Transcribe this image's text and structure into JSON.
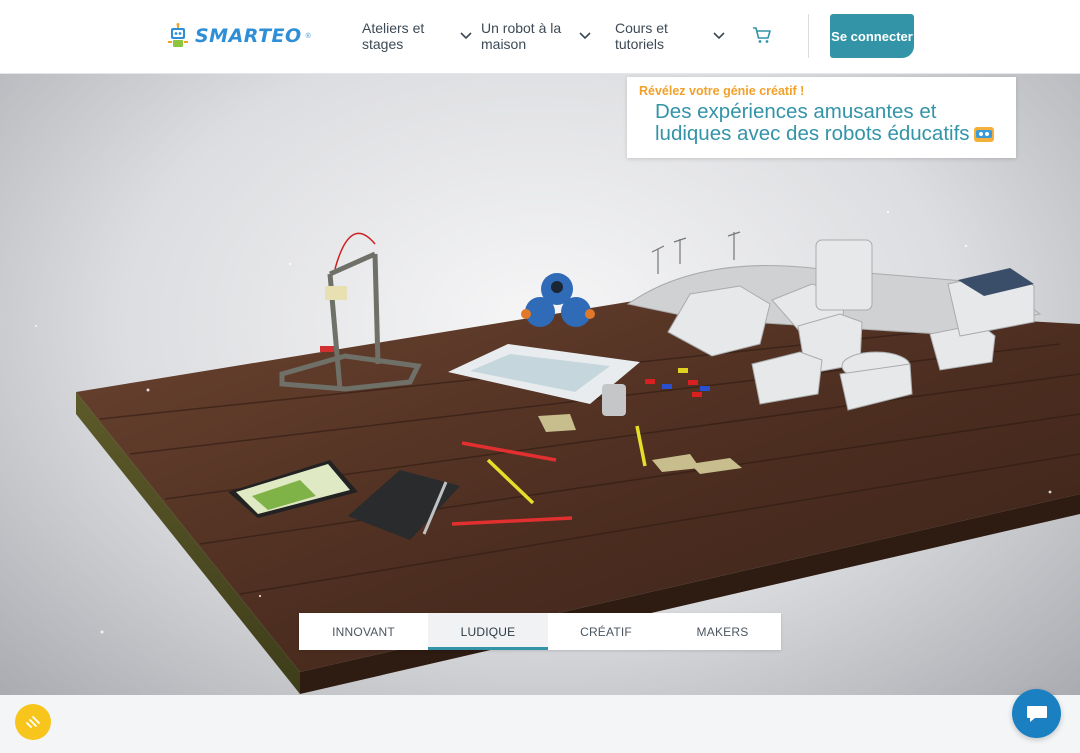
{
  "header": {
    "logo_text": "SMARTEO",
    "logo_reg": "®",
    "nav": [
      {
        "label": "Ateliers et stages"
      },
      {
        "label": "Un robot à la maison"
      },
      {
        "label": "Cours et tutoriels"
      }
    ],
    "login_label": "Se connecter"
  },
  "hero": {
    "kicker": "Révélez votre génie créatif !",
    "title": "Des expériences amusantes et ludiques avec des robots éducatifs",
    "tabs": [
      {
        "label": "INNOVANT",
        "active": false
      },
      {
        "label": "LUDIQUE",
        "active": true
      },
      {
        "label": "CRÉATIF",
        "active": false
      },
      {
        "label": "MAKERS",
        "active": false
      }
    ]
  },
  "icons": {
    "cart": "cart-icon",
    "chevron": "chevron-down-icon",
    "cookie": "cookie-settings-icon",
    "chat": "chat-icon",
    "robot_emoji": "robot-face-icon"
  },
  "colors": {
    "accent": "#3394a8",
    "logo": "#2f8fd6",
    "kicker": "#f1a12a",
    "chat": "#1b80c2",
    "cookie": "#f8c51c"
  }
}
